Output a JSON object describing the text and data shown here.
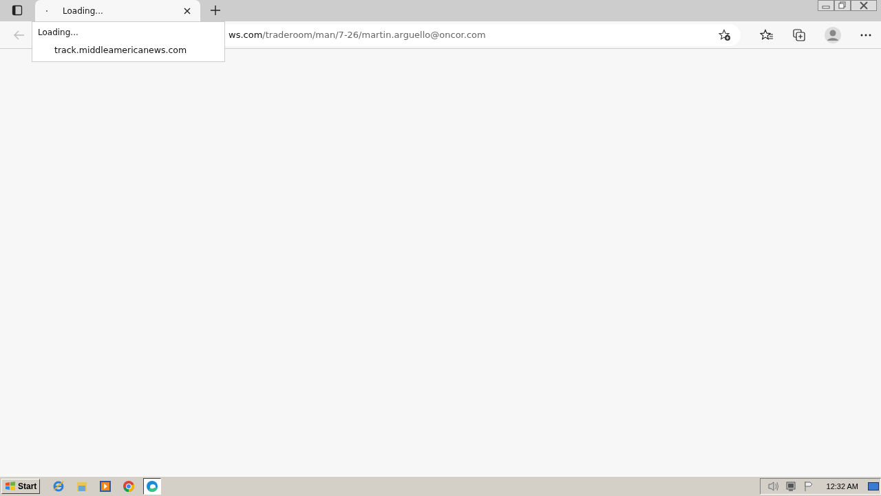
{
  "tabs": [
    {
      "title": "Loading...",
      "selected": true
    }
  ],
  "tab_popup": {
    "title": "Loading...",
    "url": "track.middleamericanews.com"
  },
  "address_bar": {
    "host": "ws.com",
    "path": "/traderoom/man/7-26/martin.arguello@oncor.com"
  },
  "taskbar": {
    "start": "Start",
    "apps": [
      {
        "kind": "ie",
        "active": false
      },
      {
        "kind": "folder",
        "active": false
      },
      {
        "kind": "media",
        "active": false
      },
      {
        "kind": "chrome",
        "active": false
      },
      {
        "kind": "edge",
        "active": true
      }
    ],
    "clock": "12:32 AM"
  }
}
